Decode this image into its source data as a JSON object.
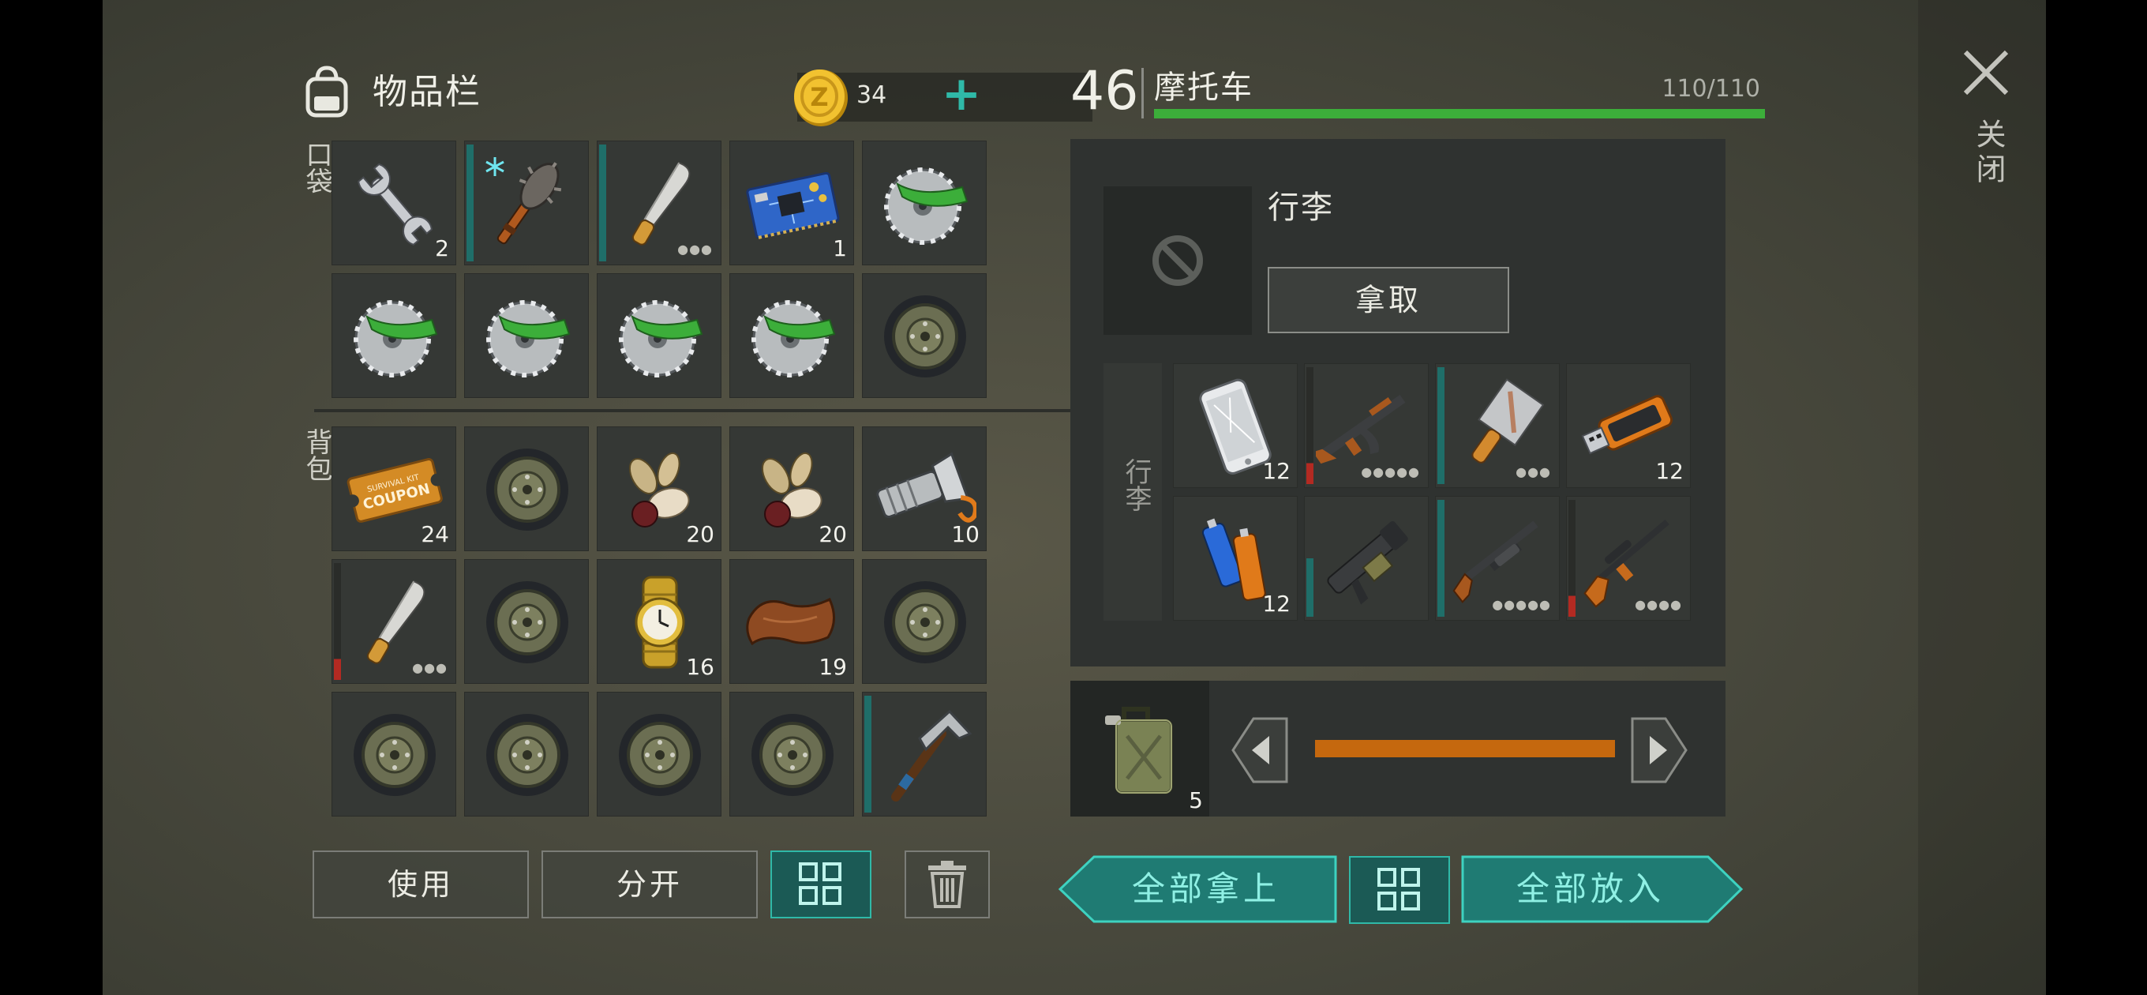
{
  "inventory": {
    "title": "物品栏",
    "coins": "34",
    "add_symbol": "+",
    "pocket_label": "口袋",
    "bag_label": "背包",
    "pocket_slots": [
      {
        "icon": "wrench-icon",
        "qty": "2"
      },
      {
        "icon": "spiked-club-icon",
        "qty": "",
        "durability": "teal",
        "frost": true
      },
      {
        "icon": "machete-icon",
        "qty": "",
        "durability": "teal",
        "dots": "●●●"
      },
      {
        "icon": "circuit-board-icon",
        "qty": "1"
      },
      {
        "icon": "saw-blade-icon",
        "qty": ""
      },
      {
        "icon": "saw-blade-icon",
        "qty": ""
      },
      {
        "icon": "saw-blade-icon",
        "qty": ""
      },
      {
        "icon": "saw-blade-icon",
        "qty": ""
      },
      {
        "icon": "saw-blade-icon",
        "qty": ""
      },
      {
        "icon": "wheel-icon",
        "qty": ""
      }
    ],
    "bag_slots": [
      {
        "icon": "coupon-icon",
        "qty": "24"
      },
      {
        "icon": "wheel-icon",
        "qty": ""
      },
      {
        "icon": "seeds-icon",
        "qty": "20"
      },
      {
        "icon": "seeds-icon",
        "qty": "20"
      },
      {
        "icon": "flashlight-icon",
        "qty": "10"
      },
      {
        "icon": "machete-icon",
        "qty": "",
        "durability": "low",
        "dots": "●●●"
      },
      {
        "icon": "wheel-icon",
        "qty": ""
      },
      {
        "icon": "wristwatch-icon",
        "qty": "16"
      },
      {
        "icon": "leather-icon",
        "qty": "19"
      },
      {
        "icon": "wheel-icon",
        "qty": ""
      },
      {
        "icon": "wheel-icon",
        "qty": ""
      },
      {
        "icon": "wheel-icon",
        "qty": ""
      },
      {
        "icon": "wheel-icon",
        "qty": ""
      },
      {
        "icon": "wheel-icon",
        "qty": ""
      },
      {
        "icon": "pickaxe-icon",
        "qty": "",
        "durability": "teal"
      }
    ],
    "coupon_text": "SURVIVAL KIT COUPON",
    "buttons": {
      "use": "使用",
      "split": "分开"
    }
  },
  "vehicle": {
    "capacity": "46",
    "name": "摩托车",
    "hp_text": "110/110",
    "hp_fraction": 1.0,
    "cargo_title": "行李",
    "take_label": "拿取",
    "cargo_side_label": "行李",
    "cargo_slots": [
      {
        "icon": "smartphone-icon",
        "qty": "12"
      },
      {
        "icon": "assault-rifle-icon",
        "qty": "",
        "durability": "low",
        "dots": "●●●●●"
      },
      {
        "icon": "cleaver-icon",
        "qty": "",
        "durability": "teal",
        "dots": "●●●"
      },
      {
        "icon": "usb-drive-icon",
        "qty": "12"
      },
      {
        "icon": "batteries-icon",
        "qty": "12"
      },
      {
        "icon": "grenade-launcher-icon",
        "qty": "",
        "durability": "teal-half"
      },
      {
        "icon": "shotgun-icon",
        "qty": "",
        "durability": "teal",
        "dots": "●●●●●"
      },
      {
        "icon": "sniper-rifle-icon",
        "qty": "",
        "durability": "low",
        "dots": "●●●●"
      }
    ],
    "fuel": {
      "qty": "5",
      "level": 1.0
    },
    "take_all": "全部拿上",
    "put_all": "全部放入"
  },
  "close_label": "关闭",
  "colors": {
    "accent": "#2fb9a8",
    "fuel": "#c5680e",
    "hp": "#3cae3a",
    "alert": "#b32a22"
  }
}
